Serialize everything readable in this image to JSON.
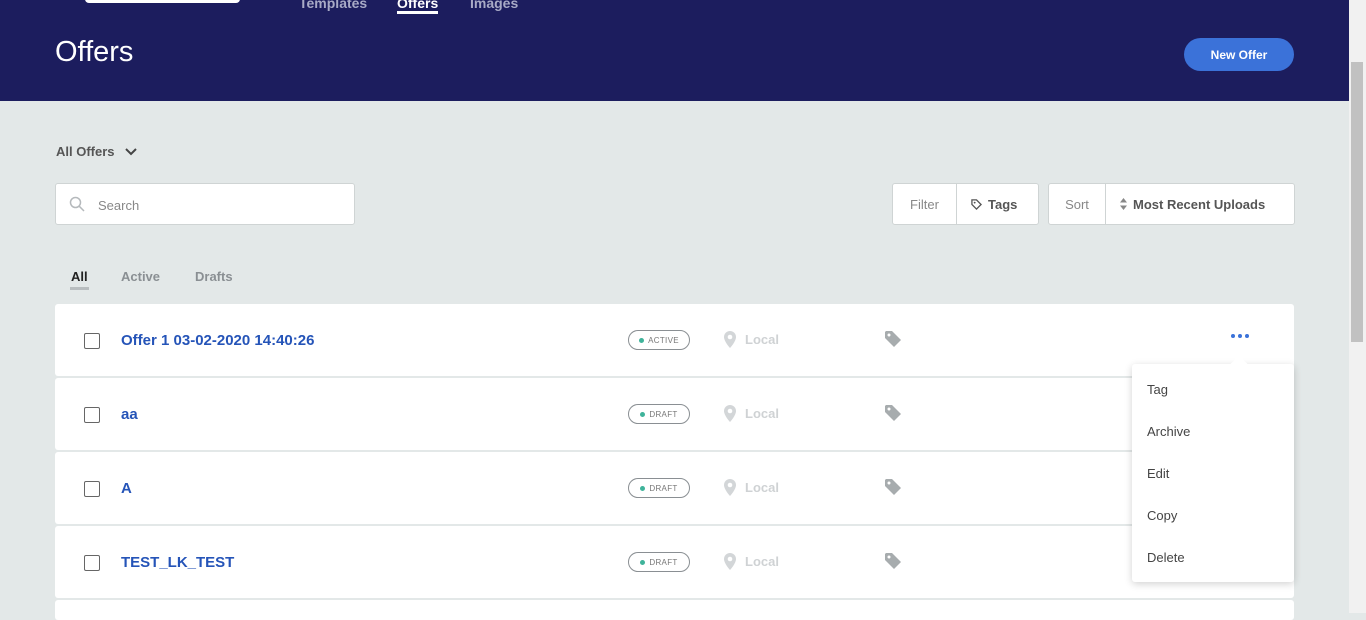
{
  "nav": {
    "items": [
      {
        "label": "Templates"
      },
      {
        "label": "Offers"
      },
      {
        "label": "Images"
      }
    ],
    "active": "Offers"
  },
  "header": {
    "title": "Offers",
    "new_button": "New Offer"
  },
  "view_selector": {
    "label": "All Offers"
  },
  "search": {
    "placeholder": "Search",
    "value": ""
  },
  "filter": {
    "label": "Filter",
    "value": "Tags"
  },
  "sort": {
    "label": "Sort",
    "value": "Most Recent Uploads"
  },
  "tabs": [
    {
      "label": "All",
      "active": true
    },
    {
      "label": "Active",
      "active": false
    },
    {
      "label": "Drafts",
      "active": false
    }
  ],
  "offers": [
    {
      "title": "Offer 1 03-02-2020 14:40:26",
      "status": "ACTIVE",
      "location": "Local"
    },
    {
      "title": "aa",
      "status": "DRAFT",
      "location": "Local"
    },
    {
      "title": "A",
      "status": "DRAFT",
      "location": "Local"
    },
    {
      "title": "TEST_LK_TEST",
      "status": "DRAFT",
      "location": "Local"
    }
  ],
  "context_menu": {
    "items": [
      "Tag",
      "Archive",
      "Edit",
      "Copy",
      "Delete"
    ]
  },
  "colors": {
    "header_bg": "#1c1d5e",
    "accent": "#3b72d9",
    "title_link": "#2554b8",
    "active_dot": "#3fb39a"
  }
}
